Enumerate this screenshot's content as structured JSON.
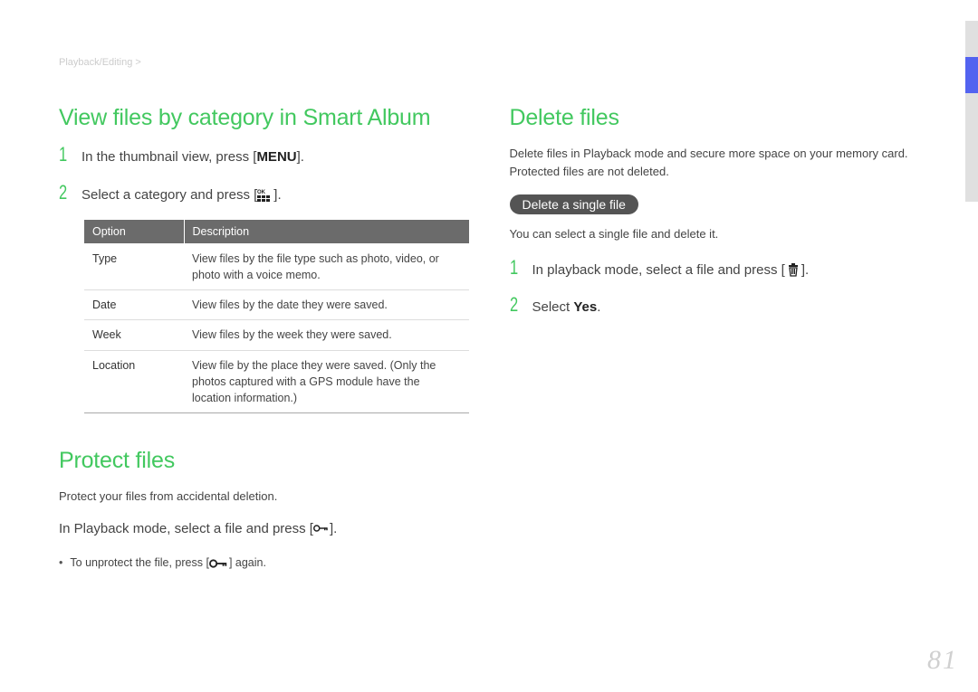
{
  "breadcrumb": "Playback/Editing >",
  "page_number": "81",
  "left": {
    "h1": "View files by category in Smart Album",
    "step1_num": "1",
    "step1_a": "In the thumbnail view, press [",
    "step1_menu": "MENU",
    "step1_b": "].",
    "step2_num": "2",
    "step2_a": "Select a category and press [",
    "step2_b": "].",
    "table": {
      "th_option": "Option",
      "th_description": "Description",
      "rows": [
        {
          "opt": "Type",
          "desc": "View files by the file type such as photo, video, or photo with a voice memo."
        },
        {
          "opt": "Date",
          "desc": "View files by the date they were saved."
        },
        {
          "opt": "Week",
          "desc": "View files by the week they were saved."
        },
        {
          "opt": "Location",
          "desc": "View file by the place they were saved. (Only the photos captured with a GPS module have the location information.)"
        }
      ]
    },
    "h2": "Protect files",
    "protect_desc": "Protect your files from accidental deletion.",
    "protect_step_a": "In Playback mode, select a file and press [",
    "protect_step_b": "].",
    "protect_bullet_a": "To unprotect the file, press [",
    "protect_bullet_b": "] again."
  },
  "right": {
    "h1": "Delete files",
    "delete_desc": "Delete files in Playback mode and secure more space on your memory card. Protected files are not deleted.",
    "pill": "Delete a single file",
    "single_desc": "You can select a single file and delete it.",
    "step1_num": "1",
    "step1_a": "In playback mode, select a file and press [",
    "step1_b": "].",
    "step2_num": "2",
    "step2_a": "Select ",
    "step2_yes": "Yes",
    "step2_b": "."
  }
}
